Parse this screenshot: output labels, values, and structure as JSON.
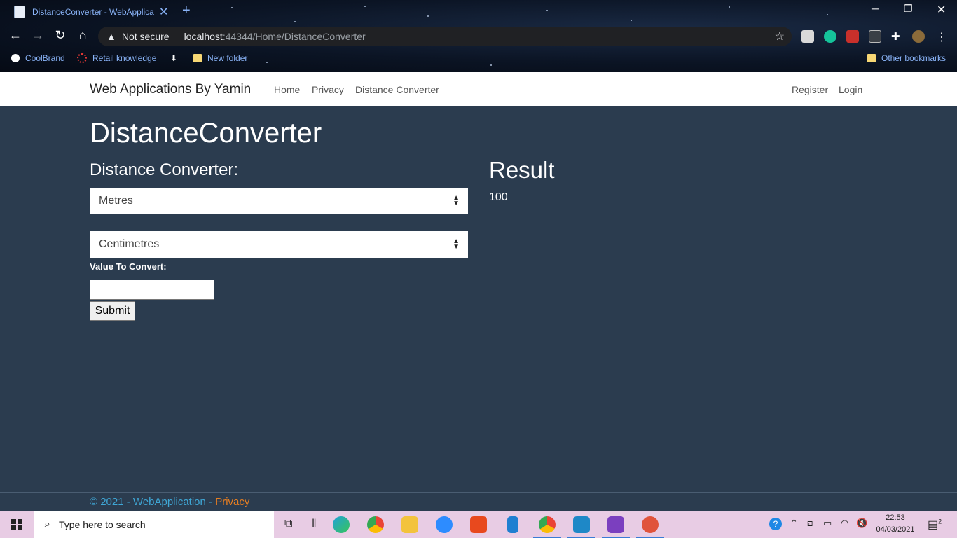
{
  "browser": {
    "tab_title": "DistanceConverter - WebApplica",
    "security_label": "Not secure",
    "url_host": "localhost",
    "url_rest": ":44344/Home/DistanceConverter",
    "bookmarks": [
      "CoolBrand",
      "Retail knowledge",
      "New folder"
    ],
    "other_bookmarks": "Other bookmarks"
  },
  "site": {
    "brand": "Web Applications By Yamin",
    "nav": [
      "Home",
      "Privacy",
      "Distance Converter"
    ],
    "nav_right": [
      "Register",
      "Login"
    ]
  },
  "main": {
    "page_title": "DistanceConverter",
    "form_heading": "Distance Converter:",
    "from_unit": "Metres",
    "to_unit": "Centimetres",
    "value_label": "Value To Convert:",
    "value_input": "",
    "submit_label": "Submit",
    "result_heading": "Result",
    "result_value": "100"
  },
  "footer": {
    "copyright": "© 2021 - WebApplication - ",
    "privacy": "Privacy"
  },
  "taskbar": {
    "search_placeholder": "Type here to search",
    "time": "22:53",
    "date": "04/03/2021",
    "notification_count": "2"
  }
}
